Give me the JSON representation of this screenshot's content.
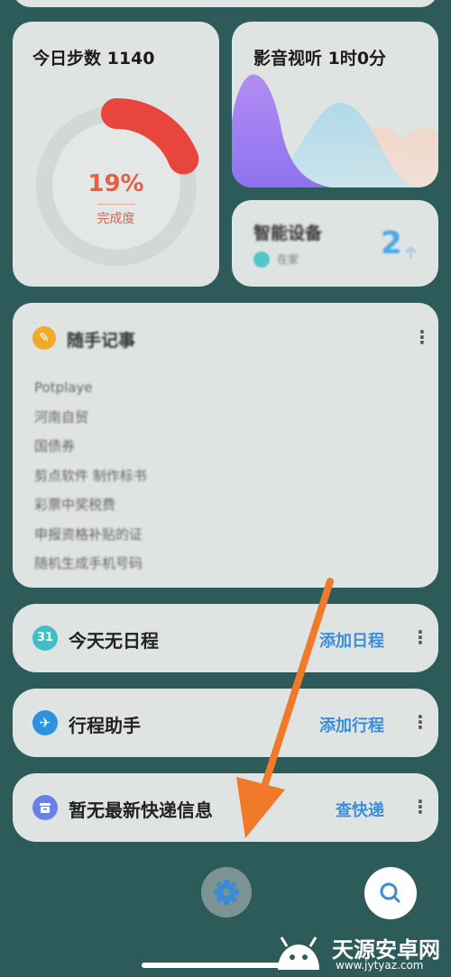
{
  "steps_widget": {
    "title": "今日步数 1140",
    "percent": "19%",
    "subtitle": "完成度",
    "progress": 0.19,
    "accent": "#e8453c"
  },
  "media_widget": {
    "title": "影音视听 1时0分"
  },
  "device_widget": {
    "title": "智能设备",
    "status": "在家",
    "count": "2",
    "unit": "个"
  },
  "notes_widget": {
    "title": "随手记事",
    "items": [
      "Potplaye",
      "河南自贸",
      "国债券",
      "剪点软件 制作标书",
      "彩票中奖税费",
      "申报资格补贴的证",
      "随机生成手机号码"
    ]
  },
  "schedule_row": {
    "icon_text": "31",
    "label": "今天无日程",
    "action": "添加日程"
  },
  "trip_row": {
    "label": "行程助手",
    "action": "添加行程"
  },
  "parcel_row": {
    "label": "暂无最新快递信息",
    "action": "查快递"
  },
  "watermark": {
    "text": "天源安卓网",
    "url": "www.jytyaz.com"
  },
  "colors": {
    "background": "#2d5b59",
    "card": "#dfe4e3",
    "link": "#3b8ed8",
    "arrow": "#f07a2a"
  }
}
